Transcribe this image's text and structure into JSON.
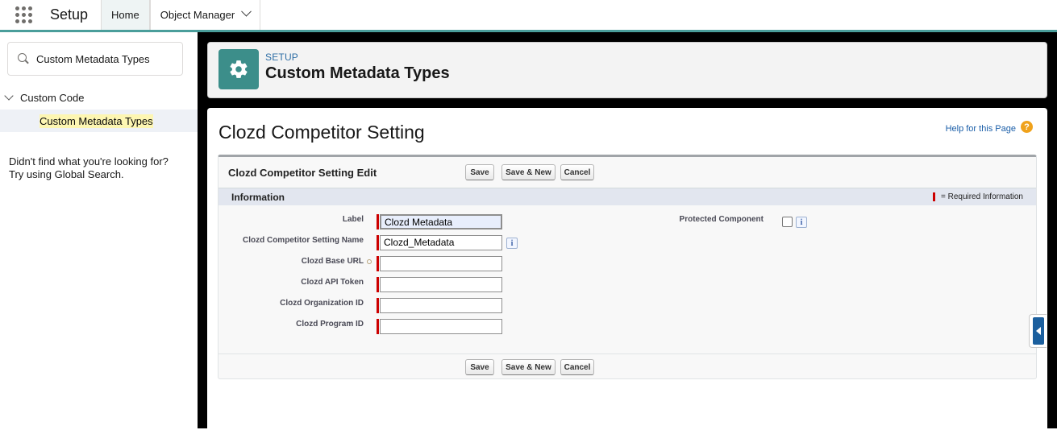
{
  "topnav": {
    "app_name": "Setup",
    "tabs": [
      {
        "label": "Home",
        "active": true
      },
      {
        "label": "Object Manager",
        "active": false
      }
    ]
  },
  "sidebar": {
    "search_value": "Custom Metadata Types",
    "tree_parent": "Custom Code",
    "tree_child": "Custom Metadata Types",
    "not_found_line1": "Didn't find what you're looking for?",
    "not_found_line2": "Try using Global Search."
  },
  "header": {
    "eyebrow": "SETUP",
    "title": "Custom Metadata Types",
    "icon": "gear-icon",
    "icon_color": "#3c8e8a"
  },
  "page": {
    "title": "Clozd Competitor Setting",
    "help_link": "Help for this Page",
    "help_icon_text": "?"
  },
  "edit_block": {
    "title": "Clozd Competitor Setting Edit",
    "buttons": {
      "save": "Save",
      "save_new": "Save & New",
      "cancel": "Cancel"
    },
    "section_title": "Information",
    "required_legend": "= Required Information",
    "fields": {
      "label": {
        "label": "Label",
        "value": "Clozd Metadata"
      },
      "setting_name": {
        "label": "Clozd Competitor Setting Name",
        "value": "Clozd_Metadata",
        "info_icon": "i"
      },
      "base_url": {
        "label": "Clozd Base URL",
        "value": ""
      },
      "api_token": {
        "label": "Clozd API Token",
        "value": ""
      },
      "org_id": {
        "label": "Clozd Organization ID",
        "value": ""
      },
      "program_id": {
        "label": "Clozd Program ID",
        "value": ""
      },
      "protected": {
        "label": "Protected Component",
        "checked": false,
        "info_icon": "i"
      }
    }
  },
  "colors": {
    "accent_bar": "#4a9e9b",
    "required": "#cc0000",
    "link": "#1a5ea8"
  }
}
